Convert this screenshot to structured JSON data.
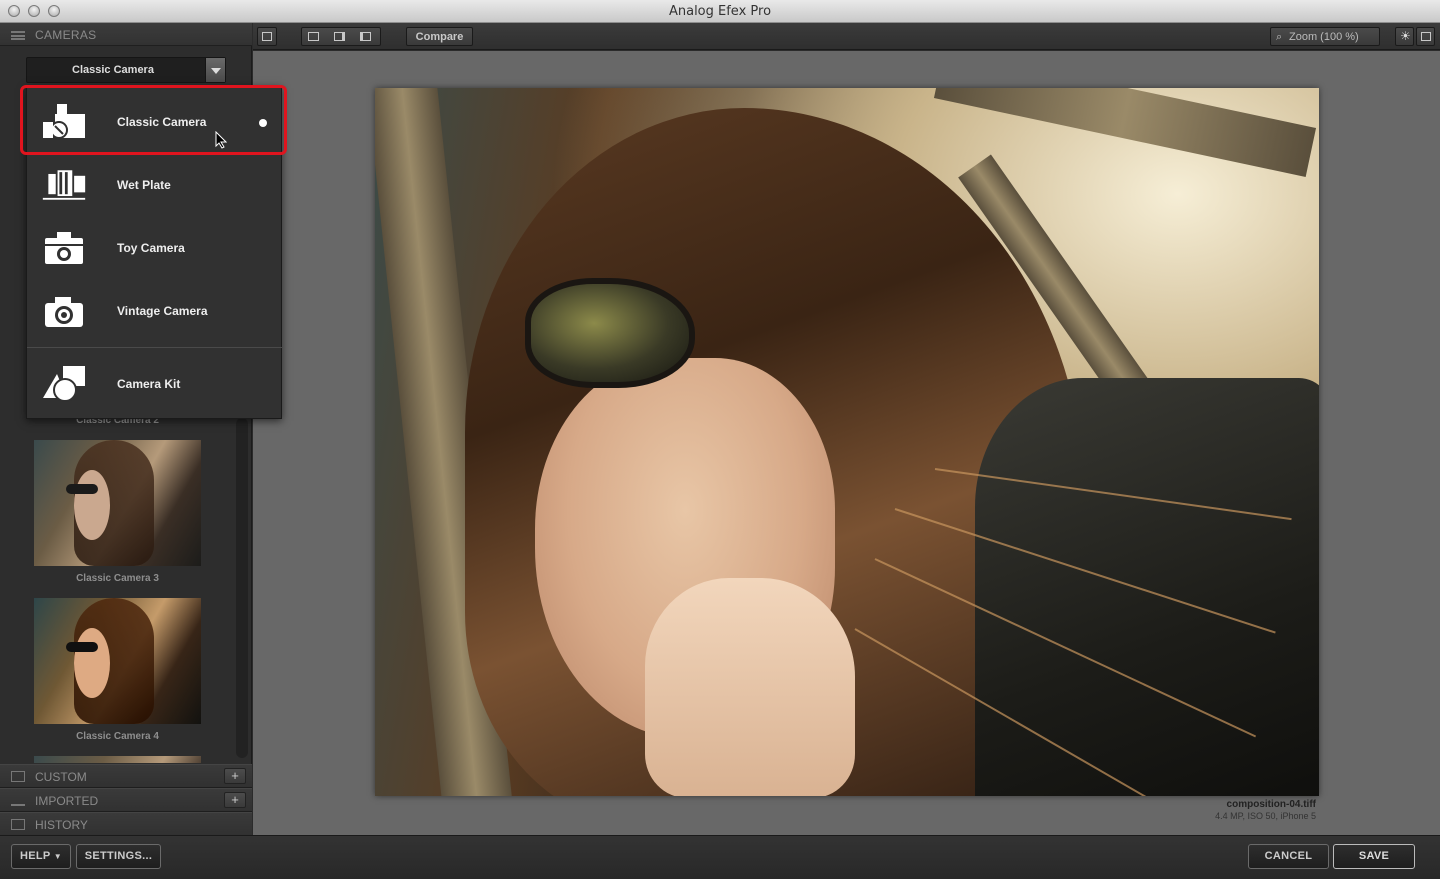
{
  "window": {
    "title": "Analog Efex Pro"
  },
  "sidebar": {
    "header": "CAMERAS",
    "dropdown_value": "Classic Camera",
    "menu": [
      {
        "label": "Classic Camera",
        "icon": "classic-camera-icon",
        "selected": true
      },
      {
        "label": "Wet Plate",
        "icon": "wet-plate-icon"
      },
      {
        "label": "Toy Camera",
        "icon": "toy-camera-icon"
      },
      {
        "label": "Vintage Camera",
        "icon": "vintage-camera-icon"
      },
      {
        "label": "Camera Kit",
        "icon": "camera-kit-icon"
      }
    ],
    "presets": [
      {
        "label": "Classic Camera 2"
      },
      {
        "label": "Classic Camera 3"
      },
      {
        "label": "Classic Camera 4"
      }
    ],
    "sections": [
      {
        "label": "CUSTOM",
        "has_add": true
      },
      {
        "label": "IMPORTED",
        "has_add": true
      },
      {
        "label": "HISTORY",
        "has_add": false
      }
    ]
  },
  "toolbar": {
    "compare_label": "Compare",
    "zoom_label": "Zoom (100 %)"
  },
  "image": {
    "filename": "composition-04.tiff",
    "meta": "4.4 MP, ISO 50, iPhone 5"
  },
  "footer": {
    "help_label": "HELP",
    "settings_label": "SETTINGS...",
    "cancel_label": "CANCEL",
    "save_label": "SAVE"
  }
}
